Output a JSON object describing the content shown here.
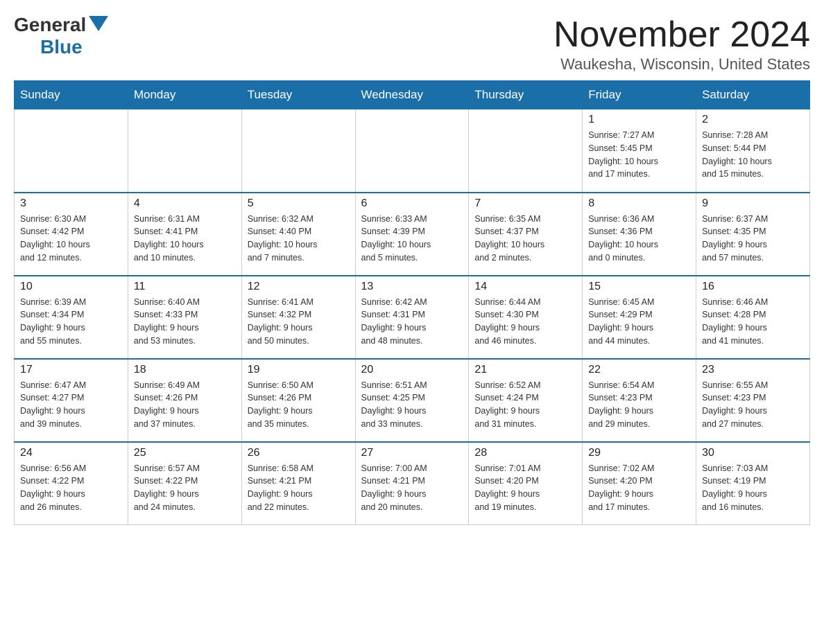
{
  "header": {
    "logo": {
      "general": "General",
      "blue": "Blue"
    },
    "title": "November 2024",
    "subtitle": "Waukesha, Wisconsin, United States"
  },
  "days_of_week": [
    "Sunday",
    "Monday",
    "Tuesday",
    "Wednesday",
    "Thursday",
    "Friday",
    "Saturday"
  ],
  "weeks": [
    [
      {
        "day": "",
        "info": ""
      },
      {
        "day": "",
        "info": ""
      },
      {
        "day": "",
        "info": ""
      },
      {
        "day": "",
        "info": ""
      },
      {
        "day": "",
        "info": ""
      },
      {
        "day": "1",
        "info": "Sunrise: 7:27 AM\nSunset: 5:45 PM\nDaylight: 10 hours\nand 17 minutes."
      },
      {
        "day": "2",
        "info": "Sunrise: 7:28 AM\nSunset: 5:44 PM\nDaylight: 10 hours\nand 15 minutes."
      }
    ],
    [
      {
        "day": "3",
        "info": "Sunrise: 6:30 AM\nSunset: 4:42 PM\nDaylight: 10 hours\nand 12 minutes."
      },
      {
        "day": "4",
        "info": "Sunrise: 6:31 AM\nSunset: 4:41 PM\nDaylight: 10 hours\nand 10 minutes."
      },
      {
        "day": "5",
        "info": "Sunrise: 6:32 AM\nSunset: 4:40 PM\nDaylight: 10 hours\nand 7 minutes."
      },
      {
        "day": "6",
        "info": "Sunrise: 6:33 AM\nSunset: 4:39 PM\nDaylight: 10 hours\nand 5 minutes."
      },
      {
        "day": "7",
        "info": "Sunrise: 6:35 AM\nSunset: 4:37 PM\nDaylight: 10 hours\nand 2 minutes."
      },
      {
        "day": "8",
        "info": "Sunrise: 6:36 AM\nSunset: 4:36 PM\nDaylight: 10 hours\nand 0 minutes."
      },
      {
        "day": "9",
        "info": "Sunrise: 6:37 AM\nSunset: 4:35 PM\nDaylight: 9 hours\nand 57 minutes."
      }
    ],
    [
      {
        "day": "10",
        "info": "Sunrise: 6:39 AM\nSunset: 4:34 PM\nDaylight: 9 hours\nand 55 minutes."
      },
      {
        "day": "11",
        "info": "Sunrise: 6:40 AM\nSunset: 4:33 PM\nDaylight: 9 hours\nand 53 minutes."
      },
      {
        "day": "12",
        "info": "Sunrise: 6:41 AM\nSunset: 4:32 PM\nDaylight: 9 hours\nand 50 minutes."
      },
      {
        "day": "13",
        "info": "Sunrise: 6:42 AM\nSunset: 4:31 PM\nDaylight: 9 hours\nand 48 minutes."
      },
      {
        "day": "14",
        "info": "Sunrise: 6:44 AM\nSunset: 4:30 PM\nDaylight: 9 hours\nand 46 minutes."
      },
      {
        "day": "15",
        "info": "Sunrise: 6:45 AM\nSunset: 4:29 PM\nDaylight: 9 hours\nand 44 minutes."
      },
      {
        "day": "16",
        "info": "Sunrise: 6:46 AM\nSunset: 4:28 PM\nDaylight: 9 hours\nand 41 minutes."
      }
    ],
    [
      {
        "day": "17",
        "info": "Sunrise: 6:47 AM\nSunset: 4:27 PM\nDaylight: 9 hours\nand 39 minutes."
      },
      {
        "day": "18",
        "info": "Sunrise: 6:49 AM\nSunset: 4:26 PM\nDaylight: 9 hours\nand 37 minutes."
      },
      {
        "day": "19",
        "info": "Sunrise: 6:50 AM\nSunset: 4:26 PM\nDaylight: 9 hours\nand 35 minutes."
      },
      {
        "day": "20",
        "info": "Sunrise: 6:51 AM\nSunset: 4:25 PM\nDaylight: 9 hours\nand 33 minutes."
      },
      {
        "day": "21",
        "info": "Sunrise: 6:52 AM\nSunset: 4:24 PM\nDaylight: 9 hours\nand 31 minutes."
      },
      {
        "day": "22",
        "info": "Sunrise: 6:54 AM\nSunset: 4:23 PM\nDaylight: 9 hours\nand 29 minutes."
      },
      {
        "day": "23",
        "info": "Sunrise: 6:55 AM\nSunset: 4:23 PM\nDaylight: 9 hours\nand 27 minutes."
      }
    ],
    [
      {
        "day": "24",
        "info": "Sunrise: 6:56 AM\nSunset: 4:22 PM\nDaylight: 9 hours\nand 26 minutes."
      },
      {
        "day": "25",
        "info": "Sunrise: 6:57 AM\nSunset: 4:22 PM\nDaylight: 9 hours\nand 24 minutes."
      },
      {
        "day": "26",
        "info": "Sunrise: 6:58 AM\nSunset: 4:21 PM\nDaylight: 9 hours\nand 22 minutes."
      },
      {
        "day": "27",
        "info": "Sunrise: 7:00 AM\nSunset: 4:21 PM\nDaylight: 9 hours\nand 20 minutes."
      },
      {
        "day": "28",
        "info": "Sunrise: 7:01 AM\nSunset: 4:20 PM\nDaylight: 9 hours\nand 19 minutes."
      },
      {
        "day": "29",
        "info": "Sunrise: 7:02 AM\nSunset: 4:20 PM\nDaylight: 9 hours\nand 17 minutes."
      },
      {
        "day": "30",
        "info": "Sunrise: 7:03 AM\nSunset: 4:19 PM\nDaylight: 9 hours\nand 16 minutes."
      }
    ]
  ]
}
